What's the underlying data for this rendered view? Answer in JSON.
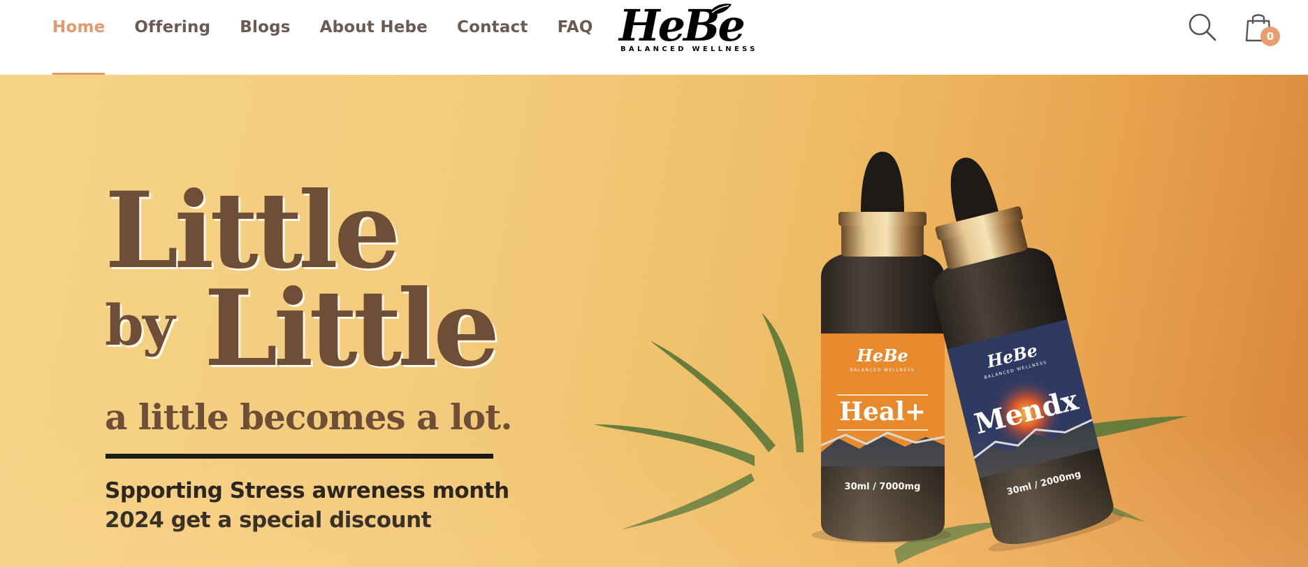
{
  "nav": {
    "items": [
      {
        "label": "Home",
        "active": true
      },
      {
        "label": "Offering",
        "active": false
      },
      {
        "label": "Blogs",
        "active": false
      },
      {
        "label": "About Hebe",
        "active": false
      },
      {
        "label": "Contact",
        "active": false
      },
      {
        "label": "FAQ",
        "active": false
      }
    ]
  },
  "brand": {
    "name": "HeBe",
    "tagline": "BALANCED WELLNESS"
  },
  "header_actions": {
    "search_icon": "search-icon",
    "cart_icon": "shopping-bag-icon",
    "cart_count": "0"
  },
  "hero": {
    "headline_line1": "Little",
    "headline_by": "by",
    "headline_line2": "Little",
    "subhead": "a little becomes a lot.",
    "promo_text": "Spporting Stress awreness month 2024 get a special discount",
    "products": [
      {
        "brand": "HeBe",
        "tagline": "BALANCED WELLNESS",
        "name": "Heal+",
        "size": "30ml / 7000mg",
        "label_color": "#e88a2a"
      },
      {
        "brand": "HeBe",
        "tagline": "BALANCED WELLNESS",
        "name": "Mendx",
        "size": "30ml / 2000mg",
        "label_color": "#2f3a63"
      }
    ]
  },
  "colors": {
    "accent": "#e29a6d",
    "nav_text": "#6b5a52",
    "headline": "#6e4e37",
    "hero_bg_start": "#f5d488",
    "hero_bg_end": "#d7853a"
  }
}
